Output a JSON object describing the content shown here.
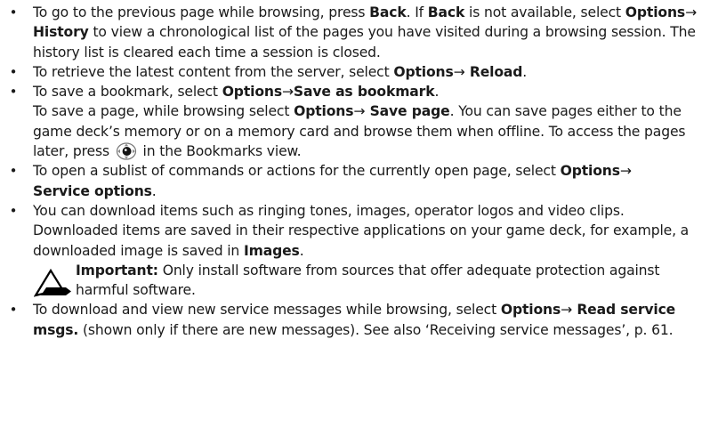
{
  "arrow": "→",
  "items": [
    {
      "t1": "To go to the previous page while browsing, press ",
      "b1": "Back",
      "t2": ". If ",
      "b2": "Back",
      "t3": " is not available, select ",
      "b3": "Options",
      "b4": " History",
      "t4": " to view a chronological list of the pages you have visited during a browsing session. The history list is cleared each time a session is closed."
    },
    {
      "t1": "To retrieve the latest content from the server, select ",
      "b1": "Options",
      "b2": " Reload",
      "t2": "."
    },
    {
      "t1": "To save a bookmark, select ",
      "b1": "Options",
      "b2": "Save as bookmark",
      "t2": ".",
      "t3": "To save a page, while browsing select ",
      "b3": "Options",
      "b4": " Save page",
      "t4": ". You can save pages either to the game deck’s memory or on a memory card and browse them when offline. To access the pages later, press ",
      "t5": " in the Bookmarks view."
    },
    {
      "t1": "To open a sublist of commands or actions for the currently open page, select ",
      "b1": "Options",
      "b2": "Service options",
      "t2": "."
    },
    {
      "t1": "You can download items such as ringing tones, images, operator logos and video clips. Downloaded items are saved in their respective applications on your game deck, for example, a downloaded image is saved in ",
      "b1": "Images",
      "t2": ".",
      "note_label": "Important:",
      "note_text": " Only install software from sources that offer adequate protection against harmful software."
    },
    {
      "t1": "To download and view new service messages while browsing, select ",
      "b1": "Options",
      "b2": " Read service msgs.",
      "t2": " (shown only if there are new messages). See also ‘Receiving service messages’, p. 61."
    }
  ],
  "icons": {
    "navi_key": "navigation-key-icon",
    "warning": "warning-icon"
  }
}
